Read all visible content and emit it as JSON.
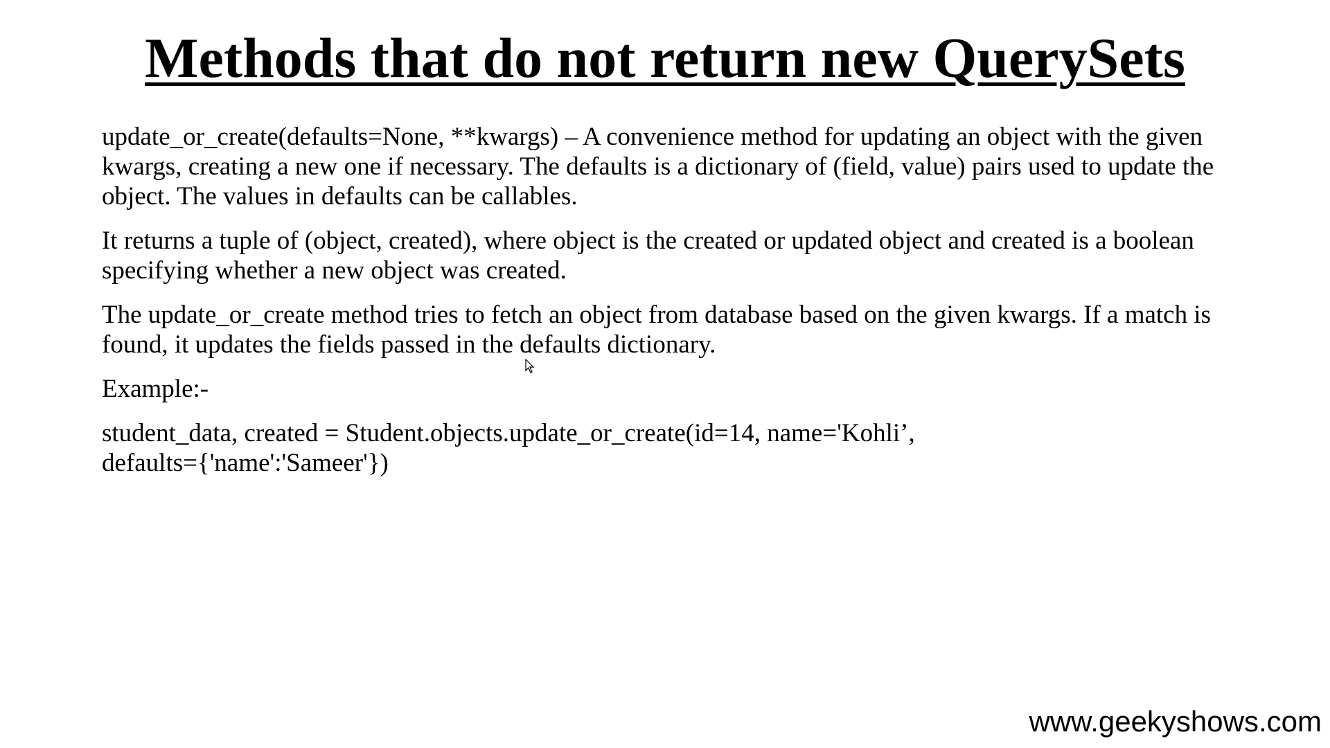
{
  "title": "Methods that do not return new QuerySets",
  "paragraphs": [
    "update_or_create(defaults=None, **kwargs) – A convenience method for updating an object with the given kwargs, creating a new one if necessary. The defaults is a dictionary of (field, value) pairs used to update the object. The values in defaults can be callables.",
    "It returns a tuple of (object, created), where object is the created or updated object and created is a boolean specifying whether a new object was created.",
    "The update_or_create method tries to fetch an object from database based on the given kwargs. If a match is found, it updates the fields passed in the defaults dictionary.",
    "Example:-"
  ],
  "example_code": {
    "line1": "student_data, created = Student.objects.update_or_create(id=14, name='Kohli’,",
    "line2": "defaults={'name':'Sameer'})"
  },
  "footer": "www.geekyshows.com"
}
